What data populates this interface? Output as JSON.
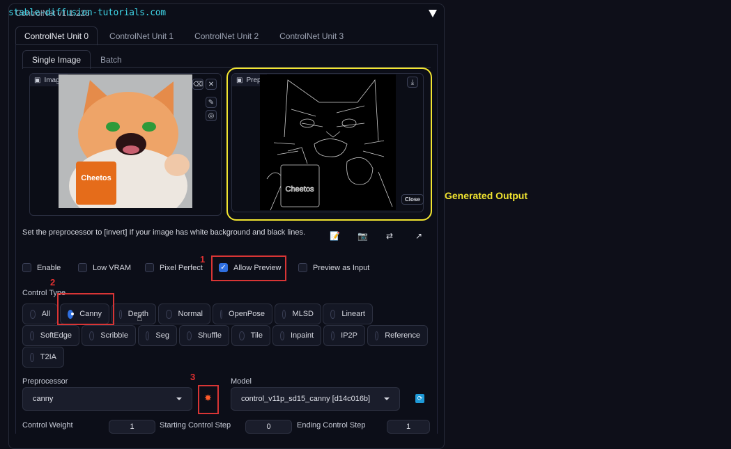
{
  "panel": {
    "title": "ControlNet v1.1.226",
    "watermark": "stable-diffusion-tutorials.com",
    "collapse_icon": "triangle-down"
  },
  "unit_tabs": [
    "ControlNet Unit 0",
    "ControlNet Unit 1",
    "ControlNet Unit 2",
    "ControlNet Unit 3"
  ],
  "active_unit_tab": 0,
  "image_tabs": [
    "Single Image",
    "Batch"
  ],
  "active_image_tab": 0,
  "input_image": {
    "label": "Image",
    "buttons": [
      "eraser-icon",
      "close-icon",
      "pen-icon",
      "palette-icon"
    ]
  },
  "preview_image": {
    "label": "Preprocessor Preview",
    "download_icon": "download-icon",
    "close_label": "Close"
  },
  "annotation_output": "Generated Output",
  "hint_text": "Set the preprocessor to [invert] If your image has white background and black lines.",
  "tool_icons": [
    "document-edit-icon",
    "camera-icon",
    "swap-icon",
    "arrow-up-right-icon"
  ],
  "checkboxes": [
    {
      "label": "Enable",
      "checked": false
    },
    {
      "label": "Low VRAM",
      "checked": false
    },
    {
      "label": "Pixel Perfect",
      "checked": false
    },
    {
      "label": "Allow Preview",
      "checked": true
    },
    {
      "label": "Preview as Input",
      "checked": false
    }
  ],
  "annotations": {
    "step1": "1",
    "step2": "2",
    "step3": "3"
  },
  "control_type": {
    "label": "Control Type",
    "options": [
      "All",
      "Canny",
      "Depth",
      "Normal",
      "OpenPose",
      "MLSD",
      "Lineart",
      "SoftEdge",
      "Scribble",
      "Seg",
      "Shuffle",
      "Tile",
      "Inpaint",
      "IP2P",
      "Reference",
      "T2IA"
    ],
    "selected": "Canny"
  },
  "preprocessor": {
    "label": "Preprocessor",
    "value": "canny",
    "run_icon": "explosion-icon"
  },
  "model": {
    "label": "Model",
    "value": "control_v11p_sd15_canny [d14c016b]",
    "refresh_icon": "refresh-icon"
  },
  "control_weight": {
    "label": "Control Weight",
    "value": "1"
  },
  "starting_step": {
    "label": "Starting Control Step",
    "value": "0"
  },
  "ending_step": {
    "label": "Ending Control Step",
    "value": "1"
  }
}
